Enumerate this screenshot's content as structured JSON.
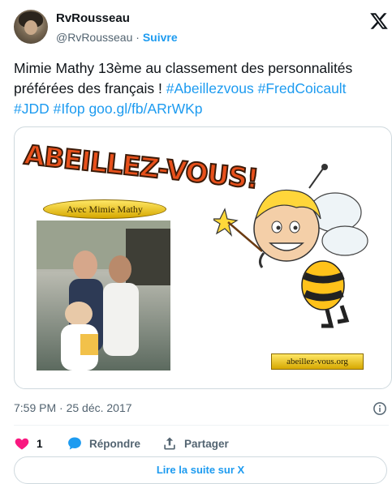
{
  "author": {
    "name": "RvRousseau",
    "handle": "@RvRousseau",
    "separator": "·",
    "follow_label": "Suivre"
  },
  "tweet": {
    "text_plain": "Mimie Mathy 13ème au classement des personnalités préférées des français !",
    "hashtag_1": "#Abeillezvous",
    "hashtag_2": "#FredCoicault",
    "hashtag_3": "#JDD",
    "hashtag_4": "#Ifop",
    "link": "goo.gl/fb/ARrWKp"
  },
  "media": {
    "logo_text": "ABEILLEZ-VOUS!",
    "caption": "Avec Mimie Mathy",
    "website": "abeillez-vous.org"
  },
  "timestamp": "7:59 PM · 25 déc. 2017",
  "actions": {
    "like_count": "1",
    "reply_label": "Répondre",
    "share_label": "Partager"
  },
  "read_more_label": "Lire la suite sur X",
  "colors": {
    "accent": "#1d9bf0",
    "like": "#f91880",
    "muted": "#536471"
  },
  "icons": {
    "brand": "x-logo-icon",
    "info": "info-icon",
    "like": "heart-icon",
    "reply": "reply-bubble-icon",
    "share": "share-icon"
  }
}
